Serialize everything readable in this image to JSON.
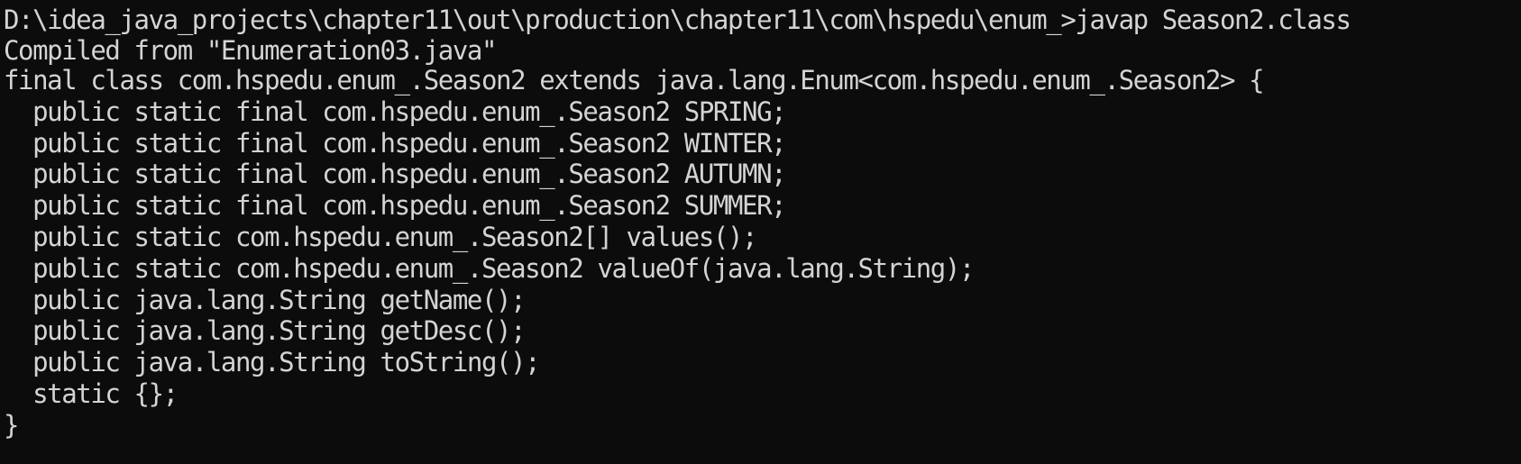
{
  "console": {
    "prompt_path": "D:\\idea_java_projects\\chapter11\\out\\production\\chapter11\\com\\hspedu\\enum_>",
    "command": "javap Season2.class",
    "output_lines": [
      "Compiled from \"Enumeration03.java\"",
      "final class com.hspedu.enum_.Season2 extends java.lang.Enum<com.hspedu.enum_.Season2> {",
      "  public static final com.hspedu.enum_.Season2 SPRING;",
      "  public static final com.hspedu.enum_.Season2 WINTER;",
      "  public static final com.hspedu.enum_.Season2 AUTUMN;",
      "  public static final com.hspedu.enum_.Season2 SUMMER;",
      "  public static com.hspedu.enum_.Season2[] values();",
      "  public static com.hspedu.enum_.Season2 valueOf(java.lang.String);",
      "  public java.lang.String getName();",
      "  public java.lang.String getDesc();",
      "  public java.lang.String toString();",
      "  static {};",
      "}"
    ]
  },
  "colors": {
    "background": "#0c0c0c",
    "text": "#d4d4d4"
  }
}
